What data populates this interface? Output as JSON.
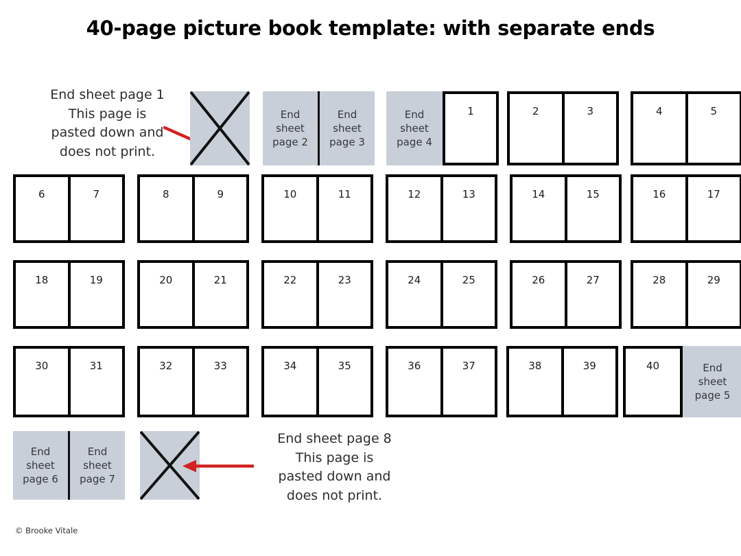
{
  "title": "40-page picture book template: with separate ends",
  "credit": "© Brooke Vitale",
  "colors": {
    "endsheet_gray": "#c9cfd8",
    "page_border": "#000000",
    "arrow_red": "#d42121",
    "text": "#2c2c2c"
  },
  "notes": {
    "top": "End sheet page 1\nThis page is\npasted down and\ndoes not print.",
    "top_lines": [
      "End sheet page 1",
      "This page is",
      "pasted down and",
      "does not print."
    ],
    "bottom": "End sheet page 8\nThis page is\npasted down and\ndoes not print.",
    "bottom_lines": [
      "End sheet page 8",
      "This page is",
      "pasted down and",
      "does not print."
    ]
  },
  "endsheets": {
    "page1": "End sheet page 1",
    "page2": "End\nsheet\npage 2",
    "page2_lines": [
      "End",
      "sheet",
      "page 2"
    ],
    "page3_lines": [
      "End",
      "sheet",
      "page 3"
    ],
    "page4_lines": [
      "End",
      "sheet",
      "page 4"
    ],
    "page5_lines": [
      "End",
      "sheet",
      "page 5"
    ],
    "page6_lines": [
      "End",
      "sheet",
      "page 6"
    ],
    "page7_lines": [
      "End",
      "sheet",
      "page 7"
    ],
    "page8": "End sheet page 8"
  },
  "icons": {
    "cross_out": "x-cross-icon",
    "arrow_right": "arrow-right-icon",
    "arrow_left": "arrow-left-icon"
  },
  "rows": [
    {
      "row_id": "row-1",
      "spreads": [
        {
          "kind": "cross",
          "label": "pasted-down-page-1"
        },
        {
          "kind": "endsheet-spread",
          "left": [
            "End",
            "sheet",
            "page 2"
          ],
          "right": [
            "End",
            "sheet",
            "page 3"
          ]
        },
        {
          "kind": "endsheet-plus-page",
          "left": [
            "End",
            "sheet",
            "page 4"
          ],
          "right": "1"
        },
        {
          "kind": "numbered",
          "left": "2",
          "right": "3"
        },
        {
          "kind": "numbered",
          "left": "4",
          "right": "5"
        }
      ]
    },
    {
      "row_id": "row-2",
      "spreads": [
        {
          "kind": "numbered",
          "left": "6",
          "right": "7"
        },
        {
          "kind": "numbered",
          "left": "8",
          "right": "9"
        },
        {
          "kind": "numbered",
          "left": "10",
          "right": "11"
        },
        {
          "kind": "numbered",
          "left": "12",
          "right": "13"
        },
        {
          "kind": "numbered",
          "left": "14",
          "right": "15"
        },
        {
          "kind": "numbered",
          "left": "16",
          "right": "17"
        }
      ]
    },
    {
      "row_id": "row-3",
      "spreads": [
        {
          "kind": "numbered",
          "left": "18",
          "right": "19"
        },
        {
          "kind": "numbered",
          "left": "20",
          "right": "21"
        },
        {
          "kind": "numbered",
          "left": "22",
          "right": "23"
        },
        {
          "kind": "numbered",
          "left": "24",
          "right": "25"
        },
        {
          "kind": "numbered",
          "left": "26",
          "right": "27"
        },
        {
          "kind": "numbered",
          "left": "28",
          "right": "29"
        }
      ]
    },
    {
      "row_id": "row-4",
      "spreads": [
        {
          "kind": "numbered",
          "left": "30",
          "right": "31"
        },
        {
          "kind": "numbered",
          "left": "32",
          "right": "33"
        },
        {
          "kind": "numbered",
          "left": "34",
          "right": "35"
        },
        {
          "kind": "numbered",
          "left": "36",
          "right": "37"
        },
        {
          "kind": "numbered",
          "left": "38",
          "right": "39"
        },
        {
          "kind": "page-plus-endsheet",
          "left": "40",
          "right": [
            "End",
            "sheet",
            "page 5"
          ]
        }
      ]
    },
    {
      "row_id": "row-5",
      "spreads": [
        {
          "kind": "endsheet-spread",
          "left": [
            "End",
            "sheet",
            "page 6"
          ],
          "right": [
            "End",
            "sheet",
            "page 7"
          ]
        },
        {
          "kind": "cross",
          "label": "pasted-down-page-8"
        }
      ]
    }
  ]
}
